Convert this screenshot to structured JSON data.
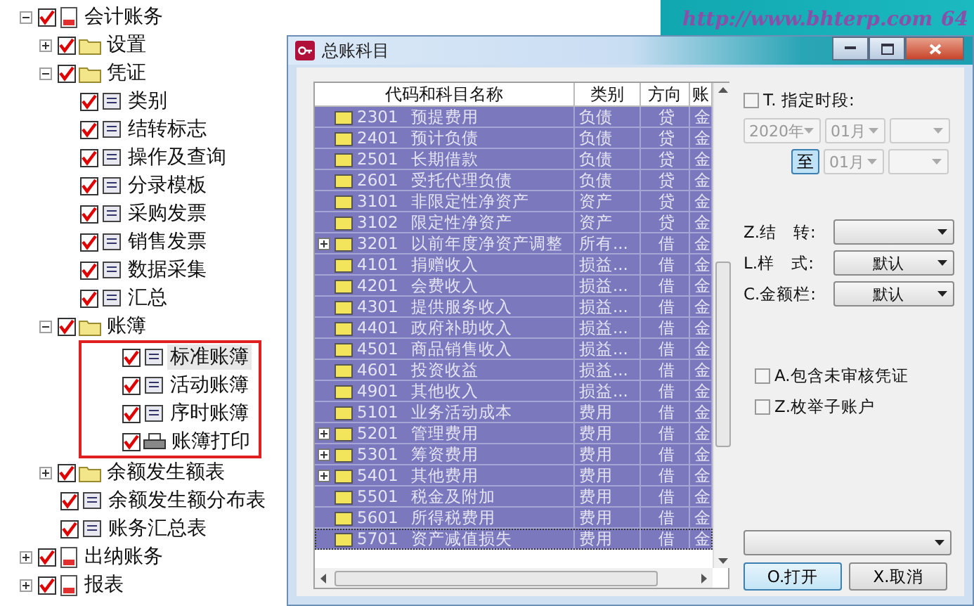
{
  "banner": {
    "url": "http://www.bhterp.com",
    "edge_text": "64"
  },
  "tree": [
    {
      "label": "会计账务",
      "kind": "module",
      "checked": true,
      "expanded": true,
      "selected": false,
      "children": [
        {
          "label": "设置",
          "kind": "folder",
          "checked": true,
          "expanded": false,
          "selected": false
        },
        {
          "label": "凭证",
          "kind": "folder",
          "checked": true,
          "expanded": true,
          "selected": false,
          "children": [
            {
              "label": "类别",
              "kind": "document",
              "checked": true,
              "selected": false
            },
            {
              "label": "结转标志",
              "kind": "document",
              "checked": true,
              "selected": false
            },
            {
              "label": "操作及查询",
              "kind": "document",
              "checked": true,
              "selected": false
            },
            {
              "label": "分录模板",
              "kind": "document",
              "checked": true,
              "selected": false
            },
            {
              "label": "采购发票",
              "kind": "document",
              "checked": true,
              "selected": false
            },
            {
              "label": "销售发票",
              "kind": "document",
              "checked": true,
              "selected": false
            },
            {
              "label": "数据采集",
              "kind": "document",
              "checked": true,
              "selected": false
            },
            {
              "label": "汇总",
              "kind": "document",
              "checked": true,
              "selected": false
            }
          ]
        },
        {
          "label": "账簿",
          "kind": "folder",
          "checked": true,
          "expanded": true,
          "selected": false,
          "framed_children": true,
          "children": [
            {
              "label": "标准账簿",
              "kind": "document",
              "checked": true,
              "selected": true
            },
            {
              "label": "活动账簿",
              "kind": "document",
              "checked": true,
              "selected": false
            },
            {
              "label": "序时账簿",
              "kind": "document",
              "checked": true,
              "selected": false
            },
            {
              "label": "账簿打印",
              "kind": "printer",
              "checked": true,
              "selected": false
            }
          ]
        },
        {
          "label": "余额发生额表",
          "kind": "folder",
          "checked": true,
          "expanded": false,
          "selected": false
        },
        {
          "label": "余额发生额分布表",
          "kind": "document",
          "checked": true,
          "selected": false
        },
        {
          "label": "账务汇总表",
          "kind": "document",
          "checked": true,
          "selected": false
        }
      ]
    },
    {
      "label": "出纳账务",
      "kind": "module",
      "checked": true,
      "expanded": false,
      "selected": false
    },
    {
      "label": "报表",
      "kind": "module",
      "checked": true,
      "expanded": false,
      "selected": false
    }
  ],
  "dialog": {
    "title": "总账科目",
    "table": {
      "columns": [
        "代码和科目名称",
        "类别",
        "方向",
        "账"
      ],
      "rows": [
        {
          "code": "2301",
          "name": "预提费用",
          "category": "负债",
          "direction": "贷",
          "column_4": "金",
          "expandable": false,
          "focused": false
        },
        {
          "code": "2401",
          "name": "预计负债",
          "category": "负债",
          "direction": "贷",
          "column_4": "金",
          "expandable": false,
          "focused": false
        },
        {
          "code": "2501",
          "name": "长期借款",
          "category": "负债",
          "direction": "贷",
          "column_4": "金",
          "expandable": false,
          "focused": false
        },
        {
          "code": "2601",
          "name": "受托代理负债",
          "category": "负债",
          "direction": "贷",
          "column_4": "金",
          "expandable": false,
          "focused": false
        },
        {
          "code": "3101",
          "name": "非限定性净资产",
          "category": "资产",
          "direction": "贷",
          "column_4": "金",
          "expandable": false,
          "focused": false
        },
        {
          "code": "3102",
          "name": "限定性净资产",
          "category": "资产",
          "direction": "贷",
          "column_4": "金",
          "expandable": false,
          "focused": false
        },
        {
          "code": "3201",
          "name": "以前年度净资产调整",
          "category": "所有...",
          "direction": "借",
          "column_4": "金",
          "expandable": true,
          "focused": false
        },
        {
          "code": "4101",
          "name": "捐赠收入",
          "category": "损益...",
          "direction": "借",
          "column_4": "金",
          "expandable": false,
          "focused": false
        },
        {
          "code": "4201",
          "name": "会费收入",
          "category": "损益...",
          "direction": "借",
          "column_4": "金",
          "expandable": false,
          "focused": false
        },
        {
          "code": "4301",
          "name": "提供服务收入",
          "category": "损益...",
          "direction": "借",
          "column_4": "金",
          "expandable": false,
          "focused": false
        },
        {
          "code": "4401",
          "name": "政府补助收入",
          "category": "损益...",
          "direction": "借",
          "column_4": "金",
          "expandable": false,
          "focused": false
        },
        {
          "code": "4501",
          "name": "商品销售收入",
          "category": "损益...",
          "direction": "借",
          "column_4": "金",
          "expandable": false,
          "focused": false
        },
        {
          "code": "4601",
          "name": "投资收益",
          "category": "损益...",
          "direction": "借",
          "column_4": "金",
          "expandable": false,
          "focused": false
        },
        {
          "code": "4901",
          "name": "其他收入",
          "category": "损益...",
          "direction": "借",
          "column_4": "金",
          "expandable": false,
          "focused": false
        },
        {
          "code": "5101",
          "name": "业务活动成本",
          "category": "费用",
          "direction": "借",
          "column_4": "金",
          "expandable": false,
          "focused": false
        },
        {
          "code": "5201",
          "name": "管理费用",
          "category": "费用",
          "direction": "借",
          "column_4": "金",
          "expandable": true,
          "focused": false
        },
        {
          "code": "5301",
          "name": "筹资费用",
          "category": "费用",
          "direction": "借",
          "column_4": "金",
          "expandable": true,
          "focused": false
        },
        {
          "code": "5401",
          "name": "其他费用",
          "category": "费用",
          "direction": "借",
          "column_4": "金",
          "expandable": true,
          "focused": false
        },
        {
          "code": "5501",
          "name": "税金及附加",
          "category": "费用",
          "direction": "借",
          "column_4": "金",
          "expandable": false,
          "focused": false
        },
        {
          "code": "5601",
          "name": "所得税费用",
          "category": "费用",
          "direction": "借",
          "column_4": "金",
          "expandable": false,
          "focused": false
        },
        {
          "code": "5701",
          "name": "资产减值损失",
          "category": "费用",
          "direction": "借",
          "column_4": "金",
          "expandable": false,
          "focused": true
        }
      ]
    },
    "period": {
      "label": "T. 指定时段:",
      "checked": false,
      "from": [
        {
          "value": "2020年",
          "disabled": true
        },
        {
          "value": "01月",
          "disabled": true
        },
        {
          "disabled": true
        }
      ],
      "to_button": "至",
      "to": [
        {
          "value": "01月",
          "disabled": true
        },
        {
          "disabled": true
        }
      ]
    },
    "options": [
      {
        "label": "Z.结　转:"
      },
      {
        "label": "L.样　式:",
        "value": "默认"
      },
      {
        "label": "C.金额栏:",
        "value": "默认"
      }
    ],
    "checkboxes": [
      {
        "label": "A.包含未审核凭证",
        "checked": false
      },
      {
        "label": "Z.枚举子账户",
        "checked": false
      }
    ],
    "bottom_select": {
      "disabled": false
    },
    "buttons": [
      {
        "label": "O.打开",
        "default": true
      },
      {
        "label": "X.取消",
        "default": false
      }
    ]
  }
}
